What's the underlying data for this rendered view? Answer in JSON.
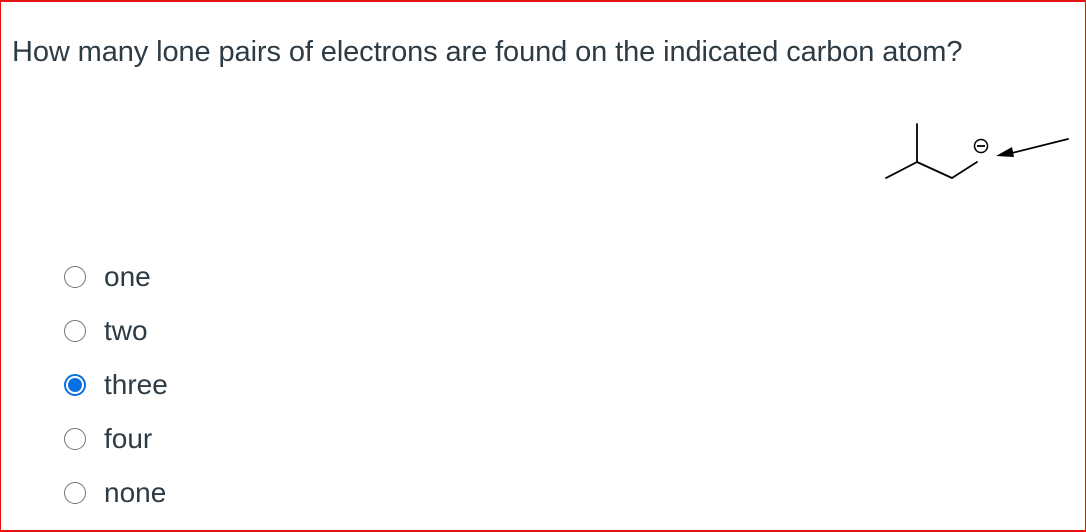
{
  "question": {
    "text": "How many lone pairs of electrons are found on the indicated carbon atom?",
    "image_icon": "carbanion-structure-with-arrow",
    "charge_symbol": "⊖"
  },
  "answers": [
    {
      "label": "one",
      "selected": false
    },
    {
      "label": "two",
      "selected": false
    },
    {
      "label": "three",
      "selected": true
    },
    {
      "label": "four",
      "selected": false
    },
    {
      "label": "none",
      "selected": false
    }
  ],
  "colors": {
    "border": "#e01414",
    "text": "#2d3b45",
    "radio_selected": "#0770e3"
  }
}
